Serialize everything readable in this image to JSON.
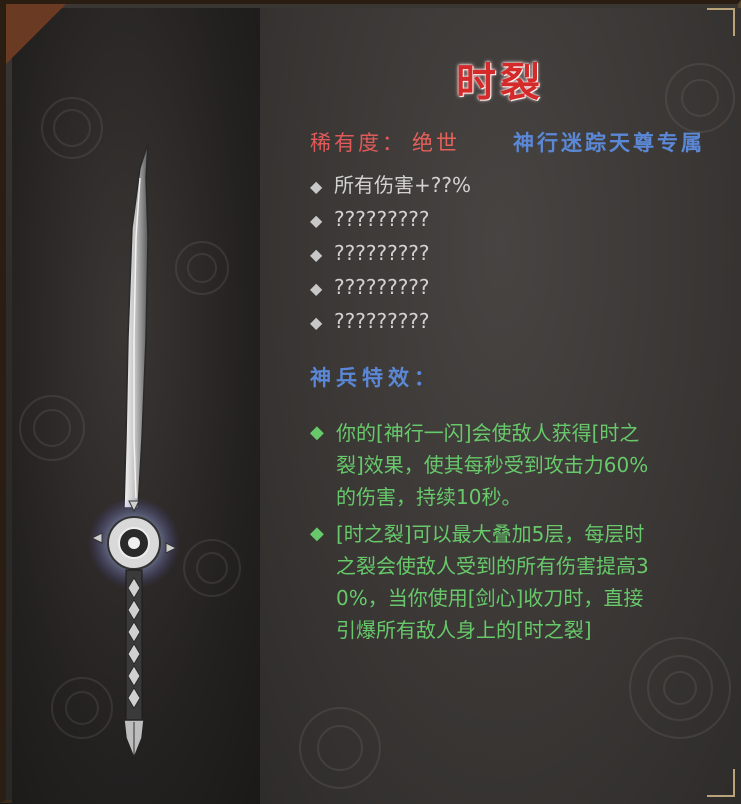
{
  "item": {
    "name": "时裂",
    "rarity_label": "稀有度：",
    "rarity_value": "绝世",
    "exclusive": "神行迷踪天尊专属"
  },
  "stats": [
    "所有伤害+??%",
    "?????????",
    "?????????",
    "?????????",
    "?????????"
  ],
  "special": {
    "heading": "神兵特效：",
    "effects": [
      {
        "lines": [
          "你的[神行一闪]会使敌人获得[时之",
          "裂]效果，使其每秒受到攻击力60%",
          "的伤害，持续10秒。"
        ]
      },
      {
        "lines": [
          "[时之裂]可以最大叠加5层，每层时",
          "之裂会使敌人受到的所有伤害提高3",
          "0%，当你使用[剑心]收刀时，直接",
          "引爆所有敌人身上的[时之裂]"
        ]
      }
    ]
  },
  "colors": {
    "title": "#d42a2a",
    "rarity": "#e15a5a",
    "exclusive": "#5b88d6",
    "stats": "#d2d2d2",
    "effects": "#67c96a"
  },
  "icons": {
    "stat_bullet": "diamond-icon",
    "effect_bullet": "diamond-icon",
    "weapon": "sword-icon"
  }
}
